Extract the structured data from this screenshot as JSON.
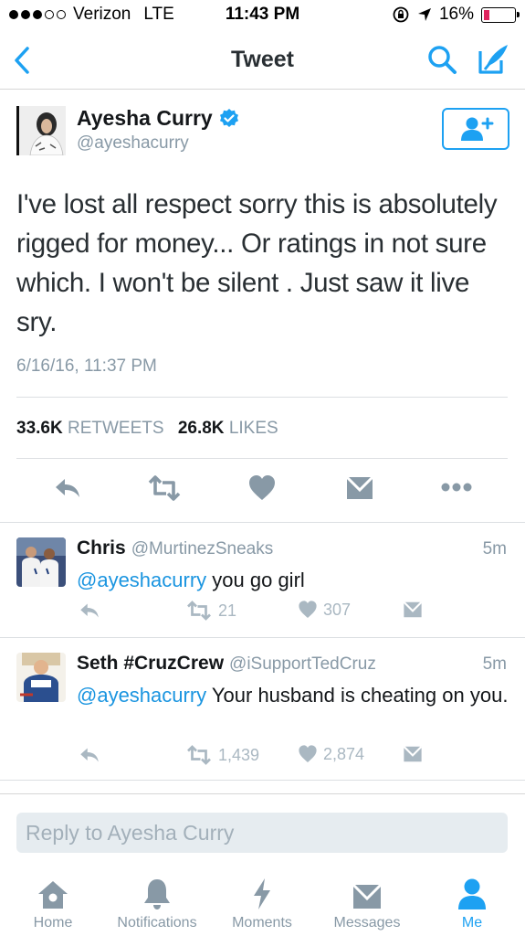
{
  "status_bar": {
    "carrier": "Verizon",
    "network": "LTE",
    "time": "11:43 PM",
    "battery": "16%"
  },
  "nav": {
    "title": "Tweet",
    "icons": [
      "back-chevron-icon",
      "search-icon",
      "compose-icon"
    ],
    "accent": "#1da1f2"
  },
  "tweet": {
    "author_name": "Ayesha Curry",
    "author_handle": "@ayeshacurry",
    "verified": true,
    "text": "I've lost all respect sorry this is absolutely rigged for money... Or ratings in not sure which. I won't be silent . Just saw it live sry.",
    "timestamp": "6/16/16, 11:37 PM",
    "retweets_count": "33.6K",
    "retweets_label": "RETWEETS",
    "likes_count": "26.8K",
    "likes_label": "LIKES"
  },
  "replies": [
    {
      "name": "Chris",
      "handle": "@MurtinezSneaks",
      "time": "5m",
      "mention": "@ayeshacurry",
      "text": " you go girl",
      "retweets": "21",
      "likes": "307"
    },
    {
      "name": "Seth #CruzCrew",
      "handle": "@iSupportTedCruz",
      "time": "5m",
      "mention": "@ayeshacurry",
      "text": " Your husband is cheating on you.",
      "retweets": "1,439",
      "likes": "2,874"
    }
  ],
  "reply_box": {
    "placeholder": "Reply to Ayesha Curry"
  },
  "tabs": [
    {
      "label": "Home",
      "icon": "home-icon"
    },
    {
      "label": "Notifications",
      "icon": "bell-icon"
    },
    {
      "label": "Moments",
      "icon": "lightning-icon"
    },
    {
      "label": "Messages",
      "icon": "envelope-icon"
    },
    {
      "label": "Me",
      "icon": "person-icon",
      "active": true
    }
  ]
}
